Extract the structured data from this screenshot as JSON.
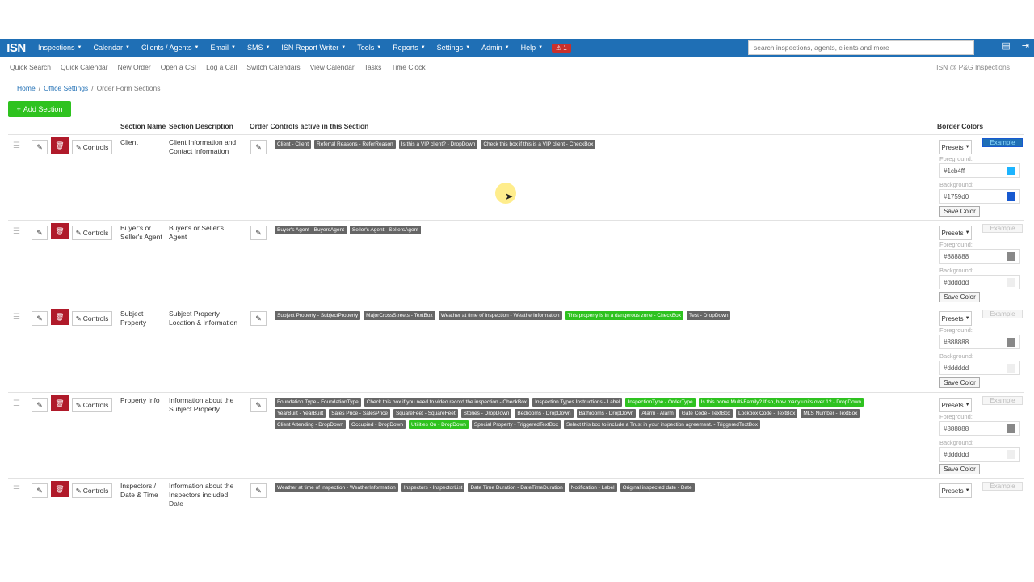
{
  "nav": {
    "logo": "ISN",
    "items": [
      "Inspections",
      "Calendar",
      "Clients / Agents",
      "Email",
      "SMS",
      "ISN Report Writer",
      "Tools",
      "Reports",
      "Settings",
      "Admin",
      "Help"
    ],
    "alert_count": "1",
    "search_placeholder": "search inspections, agents, clients and more"
  },
  "subnav": {
    "items": [
      "Quick Search",
      "Quick Calendar",
      "New Order",
      "Open a CSI",
      "Log a Call",
      "Switch Calendars",
      "View Calendar",
      "Tasks",
      "Time Clock"
    ],
    "company": "ISN @ P&G Inspections"
  },
  "breadcrumb": [
    "Home",
    "Office Settings",
    "Order Form Sections"
  ],
  "add_section_label": "Add Section",
  "headers": {
    "section_name": "Section Name",
    "section_description": "Section Description",
    "order_controls": "Order Controls active in this Section",
    "border_colors": "Border Colors"
  },
  "labels": {
    "controls": "Controls",
    "presets": "Presets",
    "example": "Example",
    "foreground": "Foreground:",
    "background": "Background:",
    "save_color": "Save Color"
  },
  "sections": [
    {
      "name": "Client",
      "description": "Client Information and Contact Information",
      "foreground": "#1cb4ff",
      "background": "#1759d0",
      "tags": [
        {
          "text": "Client - Client",
          "green": false
        },
        {
          "text": "Referral Reasons - ReferReason",
          "green": false
        },
        {
          "text": "Is this a VIP client? - DropDown",
          "green": false
        },
        {
          "text": "Check this box if this is a VIP client - CheckBox",
          "green": false
        }
      ]
    },
    {
      "name": "Buyer's or Seller's Agent",
      "description": "Buyer's or Seller's Agent",
      "foreground": "#888888",
      "background": "#dddddd",
      "tags": [
        {
          "text": "Buyer's Agent - BuyersAgent",
          "green": false
        },
        {
          "text": "Seller's Agent - SellersAgent",
          "green": false
        }
      ]
    },
    {
      "name": "Subject Property",
      "description": "Subject Property Location & Information",
      "foreground": "#888888",
      "background": "#dddddd",
      "tags": [
        {
          "text": "Subject Property - SubjectProperty",
          "green": false
        },
        {
          "text": "MajorCrossStreets - TextBox",
          "green": false
        },
        {
          "text": "Weather at time of inspection - WeatherInformation",
          "green": false
        },
        {
          "text": "This property is in a dangerous zone - CheckBox",
          "green": true
        },
        {
          "text": "Test - DropDown",
          "green": false
        }
      ]
    },
    {
      "name": "Property Info",
      "description": "Information about the Subject Property",
      "foreground": "#888888",
      "background": "#dddddd",
      "tags": [
        {
          "text": "Foundation Type - FoundationType",
          "green": false
        },
        {
          "text": "Check this box if you need to video record the inspection - CheckBox",
          "green": false
        },
        {
          "text": "Inspection Types Instructions - Label",
          "green": false
        },
        {
          "text": "InspectionType - OrderType",
          "green": true
        },
        {
          "text": "Is this home Multi-Family? If so, how many units over 1? - DropDown",
          "green": true
        },
        {
          "text": "YearBuilt - YearBuilt",
          "green": false
        },
        {
          "text": "Sales Price - SalesPrice",
          "green": false
        },
        {
          "text": "SquareFeet - SquareFeet",
          "green": false
        },
        {
          "text": "Stories - DropDown",
          "green": false
        },
        {
          "text": "Bedrooms - DropDown",
          "green": false
        },
        {
          "text": "Bathrooms - DropDown",
          "green": false
        },
        {
          "text": "Alarm - Alarm",
          "green": false
        },
        {
          "text": "Gate Code - TextBox",
          "green": false
        },
        {
          "text": "Lockbox Code - TextBox",
          "green": false
        },
        {
          "text": "MLS Number - TextBox",
          "green": false
        },
        {
          "text": "Client Attending - DropDown",
          "green": false
        },
        {
          "text": "Occupied - DropDown",
          "green": false
        },
        {
          "text": "Utilities On - DropDown",
          "green": true
        },
        {
          "text": "Special Property - TriggeredTextBox",
          "green": false
        },
        {
          "text": "Select this box to include a Trust in your inspection agreement. - TriggeredTextBox",
          "green": false
        }
      ]
    },
    {
      "name": "Inspectors / Date & Time",
      "description": "Information about the Inspectors included Date",
      "foreground": "",
      "background": "",
      "tags": [
        {
          "text": "Weather at time of inspection - WeatherInformation",
          "green": false
        },
        {
          "text": "Inspectors - InspectorList",
          "green": false
        },
        {
          "text": "Date Time Duration - DateTimeDuration",
          "green": false
        },
        {
          "text": "Notification - Label",
          "green": false
        },
        {
          "text": "Original inspected date - Date",
          "green": false
        }
      ]
    }
  ]
}
